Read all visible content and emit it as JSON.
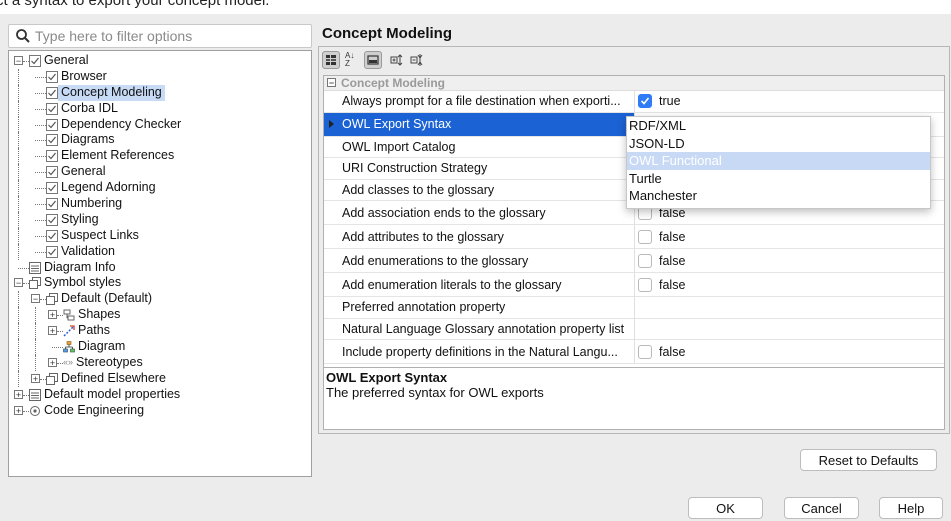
{
  "top_text": "ct a syntax to export your concept model.",
  "search": {
    "placeholder": "Type here to filter options",
    "icon": "search-icon"
  },
  "tree": [
    {
      "label": "General",
      "level": 0,
      "icon": "checkbox-icon",
      "expander": "minus"
    },
    {
      "label": "Browser",
      "level": 1,
      "icon": "checkbox-icon"
    },
    {
      "label": "Concept Modeling",
      "level": 1,
      "icon": "checkbox-icon",
      "selected": true
    },
    {
      "label": "Corba IDL",
      "level": 1,
      "icon": "checkbox-icon"
    },
    {
      "label": "Dependency Checker",
      "level": 1,
      "icon": "checkbox-icon"
    },
    {
      "label": "Diagrams",
      "level": 1,
      "icon": "checkbox-icon"
    },
    {
      "label": "Element References",
      "level": 1,
      "icon": "checkbox-icon"
    },
    {
      "label": "General",
      "level": 1,
      "icon": "checkbox-icon"
    },
    {
      "label": "Legend Adorning",
      "level": 1,
      "icon": "checkbox-icon"
    },
    {
      "label": "Numbering",
      "level": 1,
      "icon": "checkbox-icon"
    },
    {
      "label": "Styling",
      "level": 1,
      "icon": "checkbox-icon"
    },
    {
      "label": "Suspect Links",
      "level": 1,
      "icon": "checkbox-icon"
    },
    {
      "label": "Validation",
      "level": 1,
      "icon": "checkbox-icon"
    },
    {
      "label": "Diagram Info",
      "level": 0,
      "icon": "list-icon"
    },
    {
      "label": "Symbol styles",
      "level": 0,
      "icon": "styles-icon",
      "expander": "minus"
    },
    {
      "label": "Default (Default)",
      "level": 1,
      "icon": "styles-icon",
      "expander": "minus"
    },
    {
      "label": "Shapes",
      "level": 2,
      "icon": "shapes-icon",
      "expander": "plus"
    },
    {
      "label": "Paths",
      "level": 2,
      "icon": "paths-icon",
      "expander": "plus"
    },
    {
      "label": "Diagram",
      "level": 2,
      "icon": "diagram-icon"
    },
    {
      "label": "Stereotypes",
      "level": 2,
      "icon": "stereotype-icon",
      "expander": "plus",
      "prefix": "«»"
    },
    {
      "label": "Defined Elsewhere",
      "level": 1,
      "icon": "styles-icon",
      "expander": "plus"
    },
    {
      "label": "Default model properties",
      "level": 0,
      "icon": "list-icon",
      "expander": "plus"
    },
    {
      "label": "Code Engineering",
      "level": 0,
      "icon": "code-icon",
      "expander": "plus"
    }
  ],
  "page_title": "Concept Modeling",
  "toolbar": {
    "icons": [
      "categorized-view-icon",
      "sort-alpha-icon",
      "collapse-panel-icon",
      "expand-all-icon",
      "collapse-all-icon"
    ],
    "sort_label": "A↓Z"
  },
  "grid": {
    "group_label": "Concept Modeling",
    "rows": [
      {
        "name": "Always prompt for a file destination when exporti...",
        "value": "true",
        "checkbox": true,
        "checked": true
      },
      {
        "name": "OWL Export Syntax",
        "value": "",
        "selected": true
      },
      {
        "name": "OWL Import Catalog",
        "value": ""
      },
      {
        "name": "URI Construction Strategy",
        "value": ""
      },
      {
        "name": "Add classes to the glossary",
        "value": ""
      },
      {
        "name": "Add association ends to the glossary",
        "value": "false",
        "checkbox": true,
        "checked": false
      },
      {
        "name": "Add attributes to the glossary",
        "value": "false",
        "checkbox": true,
        "checked": false
      },
      {
        "name": "Add enumerations to the glossary",
        "value": "false",
        "checkbox": true,
        "checked": false
      },
      {
        "name": "Add enumeration literals to the glossary",
        "value": "false",
        "checkbox": true,
        "checked": false
      },
      {
        "name": "Preferred annotation property",
        "value": ""
      },
      {
        "name": "Natural Language Glossary annotation property list",
        "value": ""
      },
      {
        "name": "Include property definitions in the Natural Langu...",
        "value": "false",
        "checkbox": true,
        "checked": false
      }
    ]
  },
  "dropdown": {
    "options": [
      "RDF/XML",
      "JSON-LD",
      "OWL Functional",
      "Turtle",
      "Manchester"
    ],
    "highlighted": "OWL Functional"
  },
  "description": {
    "title": "OWL Export Syntax",
    "text": "The preferred syntax for OWL exports"
  },
  "buttons": {
    "reset": "Reset to Defaults",
    "ok": "OK",
    "cancel": "Cancel",
    "help": "Help"
  },
  "colors": {
    "selection": "#1b62d4",
    "checkbox_on": "#2f7cf6",
    "tree_selection": "#c7dbf6",
    "dropdown_highlight": "#c8d9f5"
  }
}
